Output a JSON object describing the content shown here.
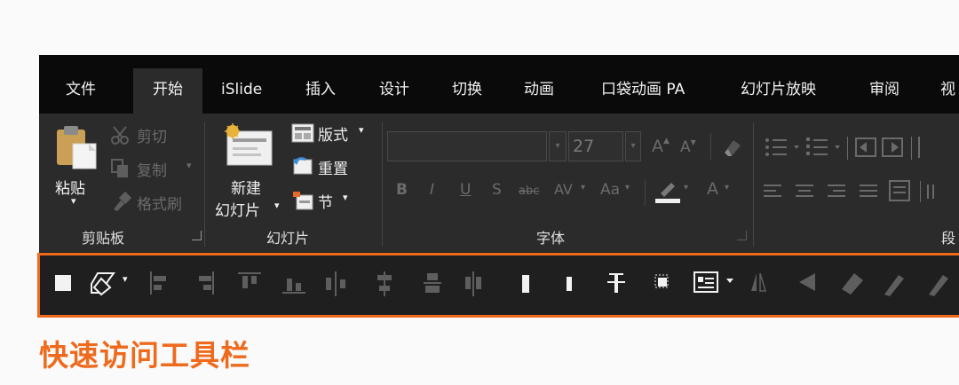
{
  "tabs": [
    {
      "label": "文件",
      "active": false
    },
    {
      "label": "开始",
      "active": true
    },
    {
      "label": "iSlide",
      "active": false
    },
    {
      "label": "插入",
      "active": false
    },
    {
      "label": "设计",
      "active": false
    },
    {
      "label": "切换",
      "active": false
    },
    {
      "label": "动画",
      "active": false
    },
    {
      "label": "口袋动画 PA",
      "active": false
    },
    {
      "label": "幻灯片放映",
      "active": false
    },
    {
      "label": "审阅",
      "active": false
    },
    {
      "label": "视",
      "active": false
    }
  ],
  "clipboard": {
    "paste": "粘贴",
    "cut": "剪切",
    "copy": "复制",
    "format_painter": "格式刷",
    "group_label": "剪贴板"
  },
  "slides": {
    "new_slide_line1": "新建",
    "new_slide_line2": "幻灯片",
    "layout": "版式",
    "reset": "重置",
    "section": "节",
    "group_label": "幻灯片"
  },
  "font": {
    "size_value": "27",
    "group_label": "字体",
    "buttons": [
      "B",
      "I",
      "U",
      "S",
      "abc",
      "AV",
      "Aa",
      "A"
    ]
  },
  "paragraph": {
    "group_label": "段"
  },
  "caption": "快速访问工具栏",
  "colors": {
    "accent": "#ee6a1c",
    "ribbon": "#2b2b2b",
    "tabbar": "#0a0a0a",
    "qat": "#1f1f1f"
  }
}
